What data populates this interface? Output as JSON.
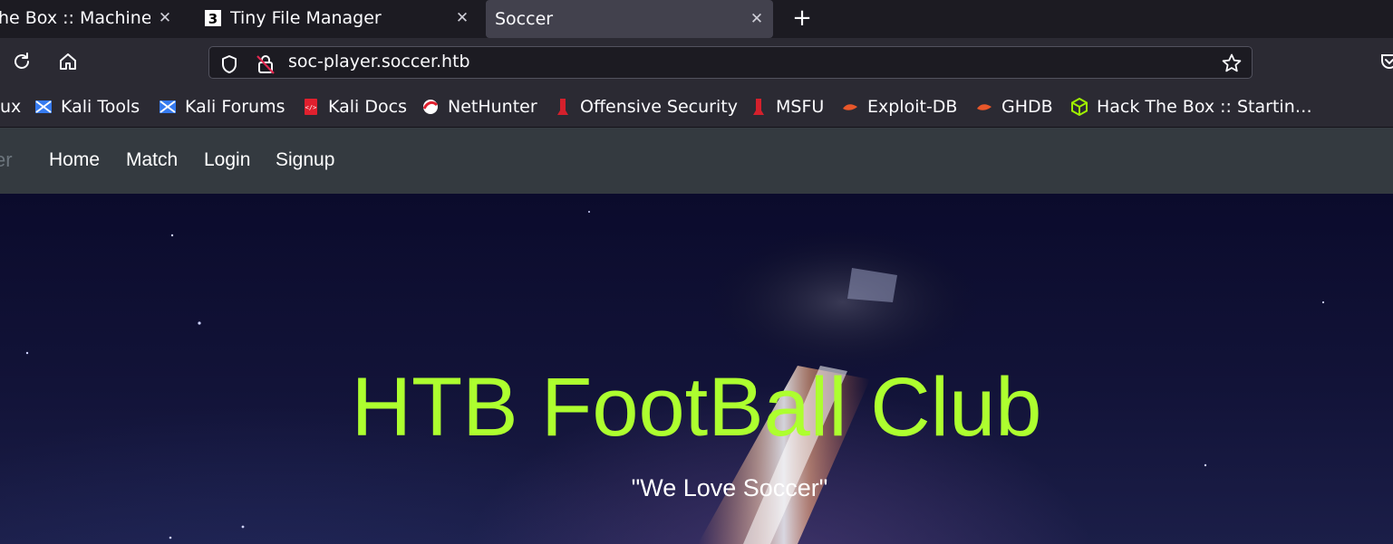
{
  "browser": {
    "tabs": [
      {
        "title": "he Box :: Machines",
        "favicon": "htb-cube-icon",
        "active": false
      },
      {
        "title": "Tiny File Manager",
        "favicon": "tiny-file-manager-icon",
        "active": false
      },
      {
        "title": "Soccer",
        "favicon": "",
        "active": true
      }
    ],
    "close_glyph": "✕",
    "new_tab_glyph": "+",
    "url": "soc-player.soccer.htb",
    "bookmarks": [
      {
        "label": "ux",
        "icon": "kali-icon"
      },
      {
        "label": "Kali Tools",
        "icon": "kali-tools-icon"
      },
      {
        "label": "Kali Forums",
        "icon": "kali-forums-icon"
      },
      {
        "label": "Kali Docs",
        "icon": "kali-docs-icon"
      },
      {
        "label": "NetHunter",
        "icon": "nethunter-icon"
      },
      {
        "label": "Offensive Security",
        "icon": "offsec-icon"
      },
      {
        "label": "MSFU",
        "icon": "msfu-icon"
      },
      {
        "label": "Exploit-DB",
        "icon": "exploit-db-icon"
      },
      {
        "label": "GHDB",
        "icon": "ghdb-icon"
      },
      {
        "label": "Hack The Box :: Startin…",
        "icon": "htb-cube-icon"
      }
    ]
  },
  "site": {
    "brand_fragment": "er",
    "nav": [
      "Home",
      "Match",
      "Login",
      "Signup"
    ],
    "hero_title": "HTB FootBall Club",
    "hero_subtitle": "\"We Love Soccer\""
  },
  "colors": {
    "hero_title": "#adff2f",
    "site_nav_bg": "#343a40",
    "browser_chrome": "#2b2a33",
    "active_tab": "#42414d"
  }
}
